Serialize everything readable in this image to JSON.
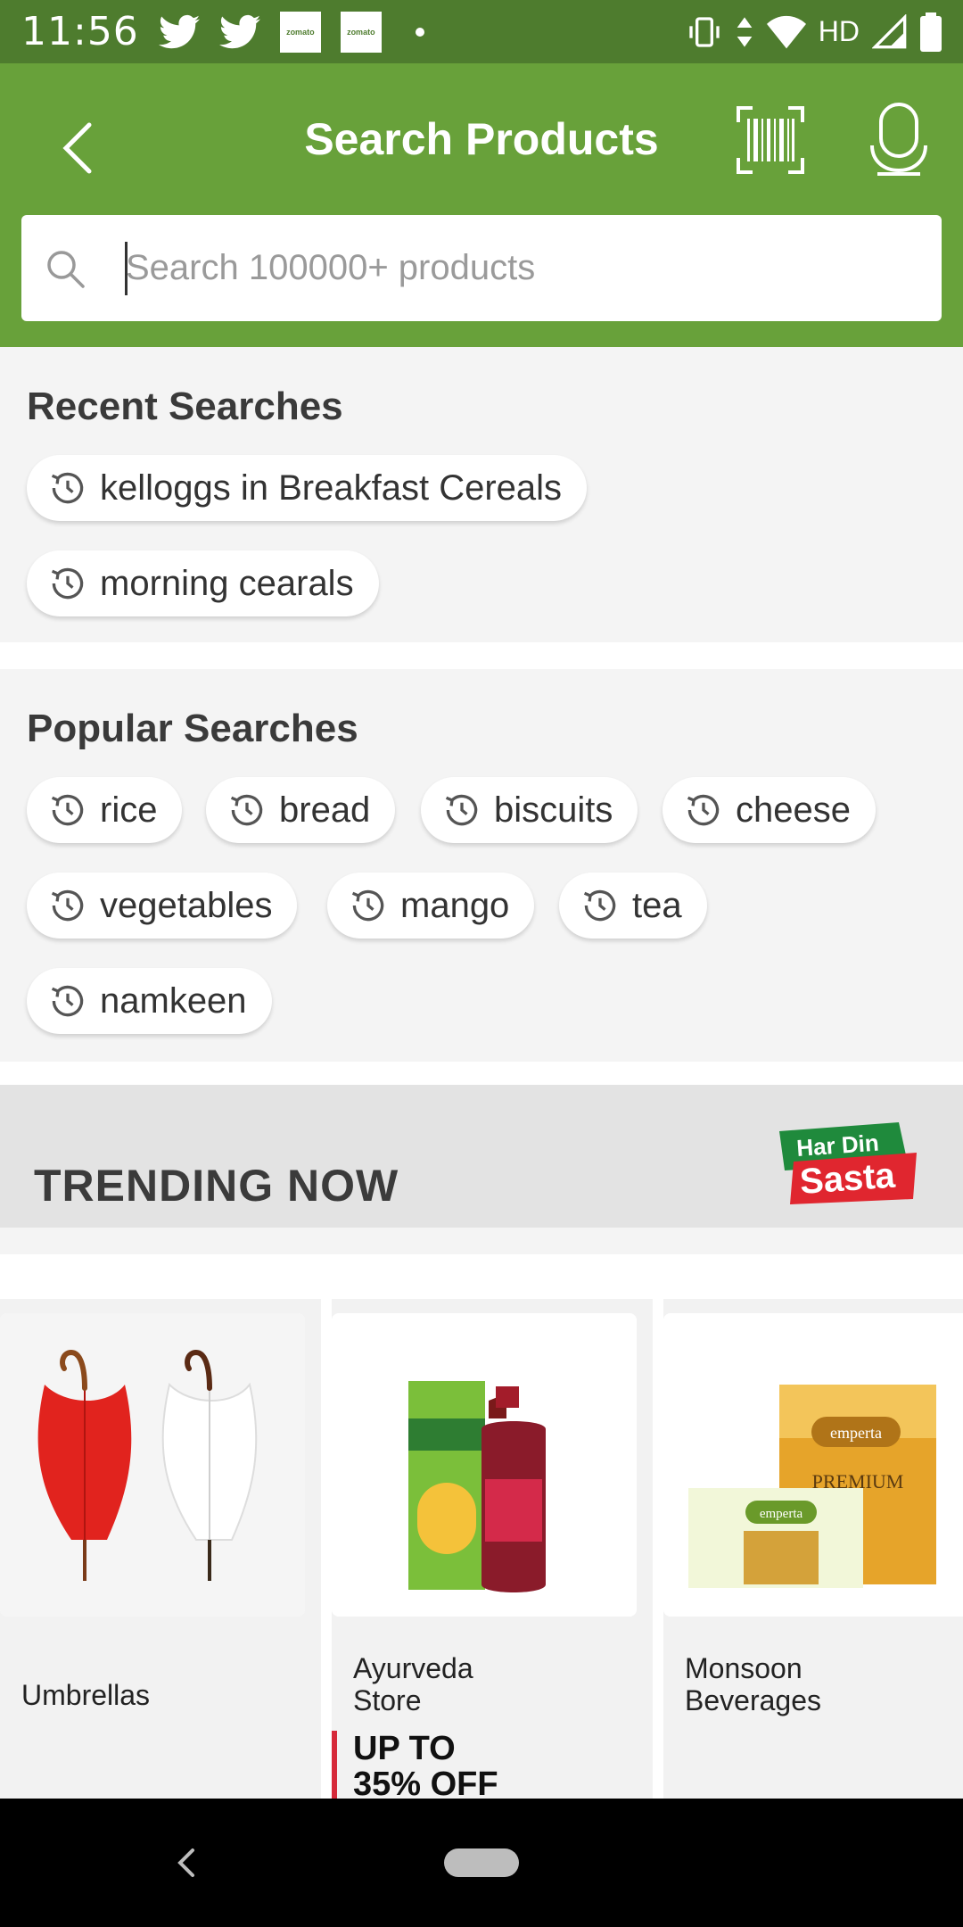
{
  "status_bar": {
    "time": "11:56",
    "notification_icons": [
      "twitter-icon",
      "twitter-icon",
      "zomato-icon",
      "zomato-icon"
    ],
    "zomato_label": "zomato",
    "network": "HD"
  },
  "header": {
    "title": "Search Products",
    "back_icon": "back-arrow-icon",
    "barcode_icon": "barcode-scan-icon",
    "mic_icon": "microphone-icon"
  },
  "search": {
    "placeholder": "Search 100000+ products"
  },
  "recent_searches": {
    "title": "Recent Searches",
    "items": [
      "kelloggs in Breakfast Cereals",
      "morning cearals"
    ]
  },
  "popular_searches": {
    "title": "Popular Searches",
    "items": [
      "rice",
      "bread",
      "biscuits",
      "cheese",
      "vegetables",
      "mango",
      "tea",
      "namkeen"
    ]
  },
  "trending": {
    "title": "TRENDING NOW",
    "logo_line1": "Har Din",
    "logo_line2": "Sasta",
    "cards": [
      {
        "label": "Umbrellas"
      },
      {
        "label": "Ayurveda Store",
        "offer": "UP TO 35% OFF"
      },
      {
        "label": "Monsoon Beverages"
      }
    ]
  },
  "colors": {
    "status_bar": "#4e7c2e",
    "app_bar": "#68a13a",
    "offer_accent": "#d62a3a"
  }
}
